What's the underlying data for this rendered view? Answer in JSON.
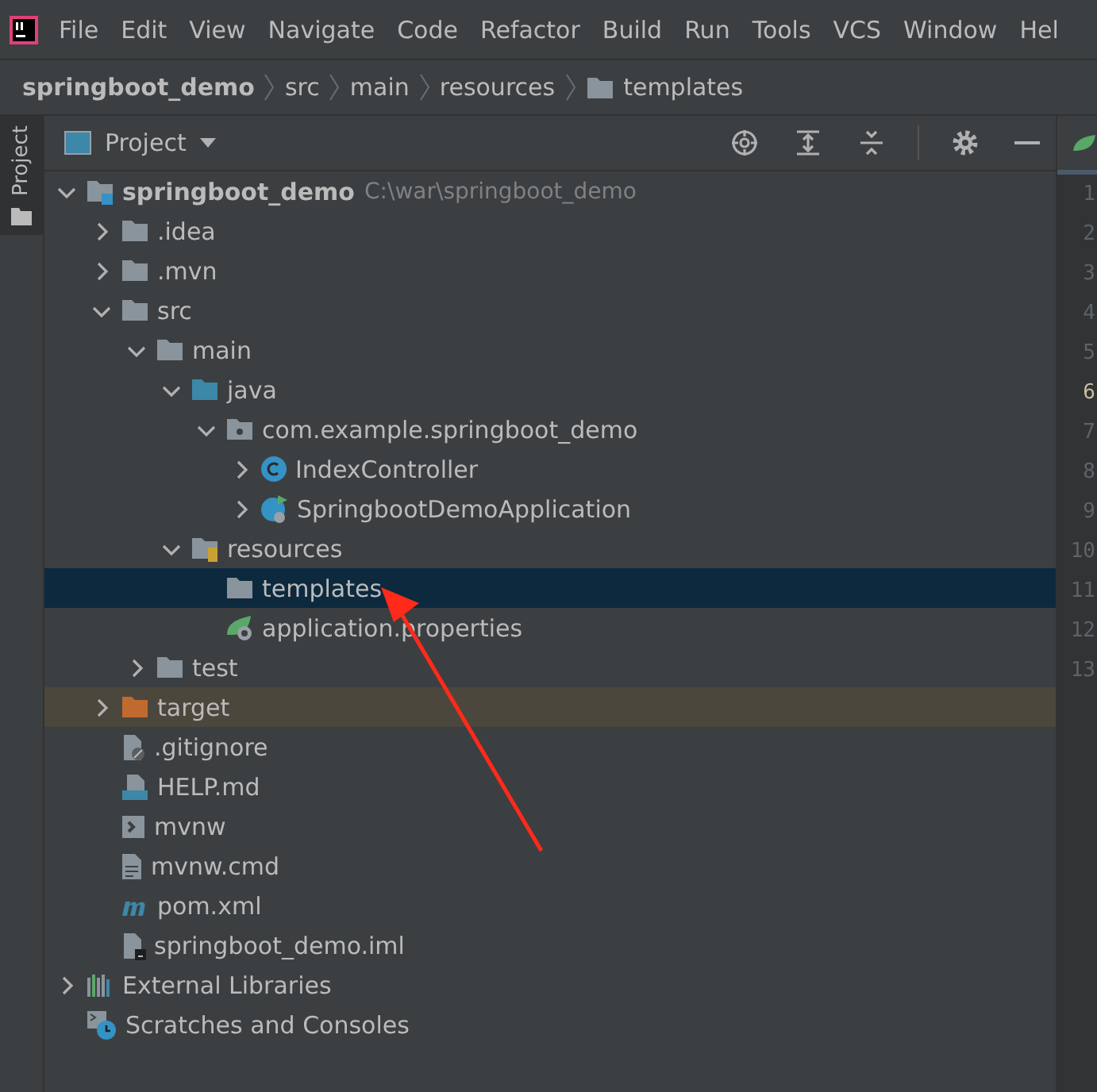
{
  "menu": [
    {
      "label": "File"
    },
    {
      "label": "Edit"
    },
    {
      "label": "View"
    },
    {
      "label": "Navigate"
    },
    {
      "label": "Code"
    },
    {
      "label": "Refactor"
    },
    {
      "label": "Build"
    },
    {
      "label": "Run"
    },
    {
      "label": "Tools"
    },
    {
      "label": "VCS"
    },
    {
      "label": "Window"
    },
    {
      "label": "Hel"
    }
  ],
  "breadcrumb": [
    {
      "label": "springboot_demo",
      "kind": "project"
    },
    {
      "label": "src",
      "kind": "plain"
    },
    {
      "label": "main",
      "kind": "plain"
    },
    {
      "label": "resources",
      "kind": "plain"
    },
    {
      "label": "templates",
      "kind": "folder"
    }
  ],
  "side_tab": {
    "label": "Project",
    "selected": true
  },
  "panel": {
    "title": "Project"
  },
  "tree": [
    {
      "label": "springboot_demo",
      "path": "C:\\war\\springboot_demo",
      "kind": "module",
      "expanded": true,
      "selected": false,
      "children": [
        {
          "label": ".idea",
          "kind": "folder",
          "expanded": false,
          "selected": false
        },
        {
          "label": ".mvn",
          "kind": "folder",
          "expanded": false,
          "selected": false
        },
        {
          "label": "src",
          "kind": "folder",
          "expanded": true,
          "selected": false,
          "children": [
            {
              "label": "main",
              "kind": "folder",
              "expanded": true,
              "selected": false,
              "children": [
                {
                  "label": "java",
                  "kind": "source-folder",
                  "expanded": true,
                  "selected": false,
                  "children": [
                    {
                      "label": "com.example.springboot_demo",
                      "kind": "package",
                      "expanded": true,
                      "selected": false,
                      "children": [
                        {
                          "label": "IndexController",
                          "kind": "class",
                          "expanded": false,
                          "selected": false
                        },
                        {
                          "label": "SpringbootDemoApplication",
                          "kind": "spring-class",
                          "expanded": false,
                          "selected": false
                        }
                      ]
                    }
                  ]
                },
                {
                  "label": "resources",
                  "kind": "resource-folder",
                  "expanded": true,
                  "selected": false,
                  "children": [
                    {
                      "label": "templates",
                      "kind": "folder",
                      "selected": true
                    },
                    {
                      "label": "application.properties",
                      "kind": "spring-config",
                      "selected": false
                    }
                  ]
                }
              ]
            },
            {
              "label": "test",
              "kind": "folder",
              "expanded": false,
              "selected": false
            }
          ]
        },
        {
          "label": "target",
          "kind": "excluded-folder",
          "expanded": false,
          "selected": false
        },
        {
          "label": ".gitignore",
          "kind": "ignore-file",
          "selected": false
        },
        {
          "label": "HELP.md",
          "kind": "markdown",
          "selected": false
        },
        {
          "label": "mvnw",
          "kind": "script",
          "selected": false
        },
        {
          "label": "mvnw.cmd",
          "kind": "text-file",
          "selected": false
        },
        {
          "label": "pom.xml",
          "kind": "maven",
          "selected": false
        },
        {
          "label": "springboot_demo.iml",
          "kind": "iml-file",
          "selected": false
        }
      ]
    },
    {
      "label": "External Libraries",
      "kind": "libraries",
      "expanded": false,
      "selected": false
    },
    {
      "label": "Scratches and Consoles",
      "kind": "scratches",
      "selected": false
    }
  ],
  "gutter": [
    {
      "label": "1",
      "current": false
    },
    {
      "label": "2",
      "current": false
    },
    {
      "label": "3",
      "current": false
    },
    {
      "label": "4",
      "current": false
    },
    {
      "label": "5",
      "current": false
    },
    {
      "label": "6",
      "current": true
    },
    {
      "label": "7",
      "current": false
    },
    {
      "label": "8",
      "current": false
    },
    {
      "label": "9",
      "current": false
    },
    {
      "label": "10",
      "current": false
    },
    {
      "label": "11",
      "current": false
    },
    {
      "label": "12",
      "current": false
    },
    {
      "label": "13",
      "current": false
    }
  ]
}
